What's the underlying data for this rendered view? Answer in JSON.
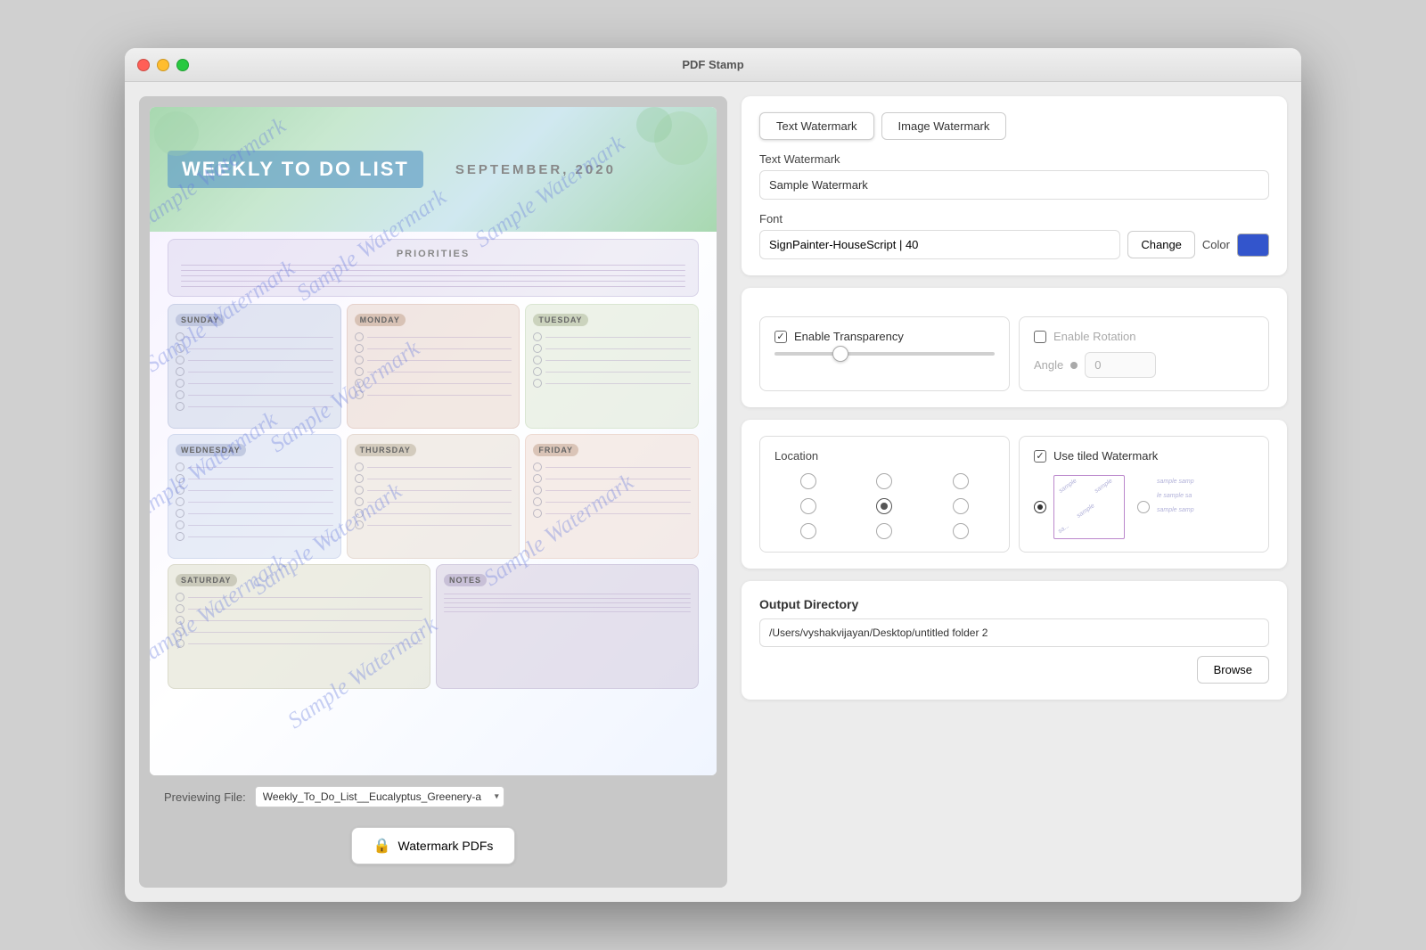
{
  "window": {
    "title": "PDF Stamp"
  },
  "tabs": {
    "text_watermark": "Text Watermark",
    "image_watermark": "Image Watermark"
  },
  "form": {
    "text_watermark_label": "Text Watermark",
    "text_watermark_value": "Sample Watermark",
    "font_label": "Font",
    "font_value": "SignPainter-HouseScript | 40",
    "change_btn": "Change",
    "color_label": "Color",
    "enable_transparency_label": "Enable Transparency",
    "enable_rotation_label": "Enable Rotation",
    "angle_label": "Angle",
    "angle_value": "0",
    "location_label": "Location",
    "use_tiled_label": "Use tiled Watermark",
    "output_dir_label": "Output Directory",
    "output_dir_value": "/Users/vyshakvijayan/Desktop/untitled folder 2",
    "browse_btn": "Browse",
    "watermark_btn": "Watermark PDFs"
  },
  "preview": {
    "label": "Previewing File:",
    "filename": "Weekly_To_Do_List__Eucalyptus_Greenery-a",
    "pdf_title": "WEEKLY TO DO LIST",
    "pdf_date": "SEPTEMBER, 2020",
    "priorities_label": "PRIORITIES",
    "days": [
      "SUNDAY",
      "MONDAY",
      "TUESDAY",
      "WEDNESDAY",
      "THURSDAY",
      "FRIDAY",
      "SATURDAY",
      "NOTES"
    ],
    "watermark_text": "Sample Watermark"
  }
}
